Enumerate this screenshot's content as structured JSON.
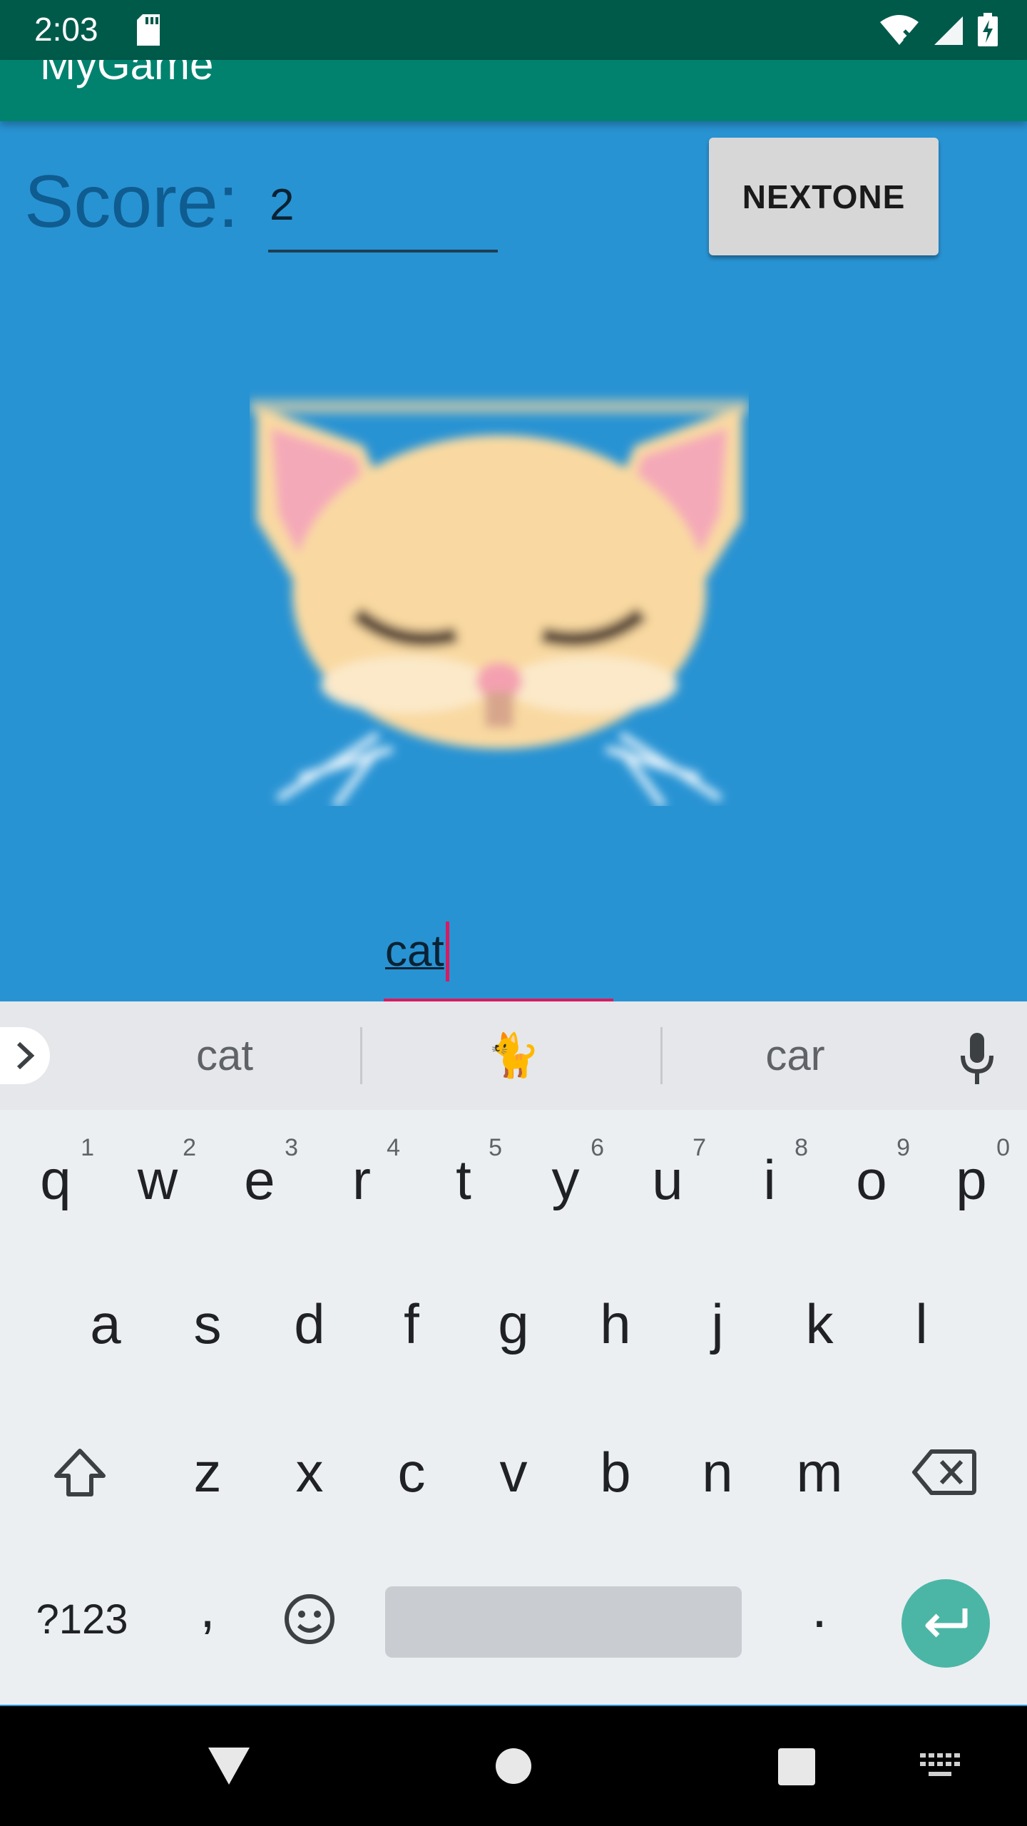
{
  "status_bar": {
    "time": "2:03"
  },
  "app": {
    "title": "MyGame"
  },
  "score": {
    "label": "Score:",
    "value": "2"
  },
  "next_button": {
    "label": "NEXTONE"
  },
  "answer": {
    "text": "cat"
  },
  "keyboard": {
    "suggestions": [
      "cat",
      "🐈",
      "car"
    ],
    "row1": [
      {
        "key": "q",
        "hint": "1"
      },
      {
        "key": "w",
        "hint": "2"
      },
      {
        "key": "e",
        "hint": "3"
      },
      {
        "key": "r",
        "hint": "4"
      },
      {
        "key": "t",
        "hint": "5"
      },
      {
        "key": "y",
        "hint": "6"
      },
      {
        "key": "u",
        "hint": "7"
      },
      {
        "key": "i",
        "hint": "8"
      },
      {
        "key": "o",
        "hint": "9"
      },
      {
        "key": "p",
        "hint": "0"
      }
    ],
    "row2": [
      "a",
      "s",
      "d",
      "f",
      "g",
      "h",
      "j",
      "k",
      "l"
    ],
    "row3": [
      "z",
      "x",
      "c",
      "v",
      "b",
      "n",
      "m"
    ],
    "symbols_label": "?123",
    "comma": ",",
    "period": "."
  },
  "colors": {
    "background": "#2893d3",
    "app_bar": "#00826f",
    "status_bar": "#005a4a",
    "accent": "#d81b60",
    "enter_key": "#4bb6a6"
  },
  "icons": [
    "sd-card-icon",
    "wifi-icon",
    "signal-icon",
    "battery-icon",
    "chevron-right-icon",
    "microphone-icon",
    "shift-icon",
    "backspace-icon",
    "emoji-icon",
    "enter-icon",
    "back-icon",
    "home-icon",
    "recents-icon",
    "keyboard-icon"
  ]
}
